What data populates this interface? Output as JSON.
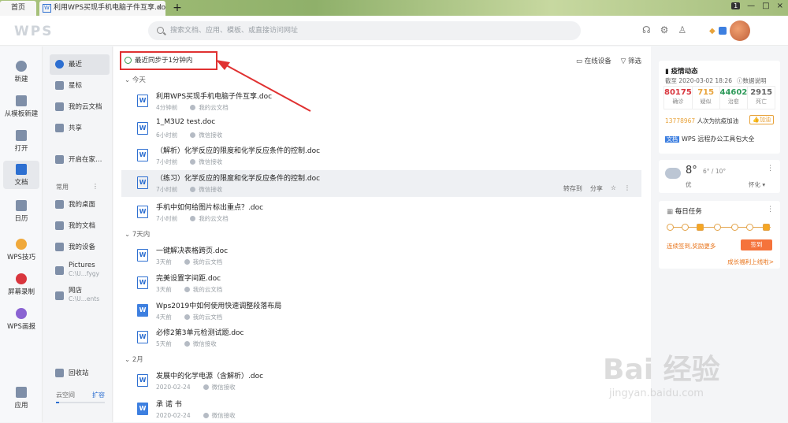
{
  "tabs": {
    "home": "首页",
    "doc": "利用WPS买现手机电脑子件互享.doc",
    "close": "×",
    "add": "+"
  },
  "window": {
    "count_badge": "1",
    "min": "—",
    "restore": "□",
    "close": "×"
  },
  "title": {
    "logo": "WPS",
    "search_placeholder": "搜索文档、应用、模板、或直接访问网址"
  },
  "leftnav": [
    "新建",
    "从模板新建",
    "打开",
    "文档",
    "日历",
    "WPS技巧",
    "屏幕录制",
    "WPS画报",
    "应用"
  ],
  "subnav": {
    "items": [
      "最近",
      "星标",
      "我的云文档",
      "共享",
      "开启在家…"
    ],
    "section": "常用",
    "section_more": "⋮",
    "common": [
      {
        "label": "我的桌面"
      },
      {
        "label": "我的文档"
      },
      {
        "label": "我的设备"
      },
      {
        "label": "Pictures",
        "sub": "C:\\U...fygy"
      },
      {
        "label": "网店",
        "sub": "C:\\U...ents"
      }
    ],
    "recycle": "回收站",
    "cloud": "云空间",
    "expand": "扩容"
  },
  "main": {
    "sync": "最近同步于1分钟内",
    "tools": [
      "在线设备",
      "筛选"
    ],
    "groups": [
      "今天",
      "7天内",
      "2月"
    ],
    "files": [
      {
        "name": "利用WPS买现手机电脑子件互享.doc",
        "time": "4分钟前",
        "loc": "我的云文档"
      },
      {
        "name": "1_M3U2 test.doc",
        "time": "6小时前",
        "loc": "微信接收"
      },
      {
        "name": "（解析）化学反应的限度和化学反应条件的控制.doc",
        "time": "7小时前",
        "loc": "微信接收"
      },
      {
        "name": "（练习）化学反应的限度和化学反应条件的控制.doc",
        "time": "7小时前",
        "loc": "微信接收"
      },
      {
        "name": "手机中如何给图片标出重点？.doc",
        "time": "7小时前",
        "loc": "我的云文档"
      },
      {
        "name": "一键解决表格跨页.doc",
        "time": "3天前",
        "loc": "我的云文档"
      },
      {
        "name": "完美设置字间距.doc",
        "time": "3天前",
        "loc": "我的云文档"
      },
      {
        "name": "Wps2019中如何使用快速调整段落布局",
        "time": "4天前",
        "loc": "我的云文档"
      },
      {
        "name": "必修2第3单元检测试题.doc",
        "time": "5天前",
        "loc": "微信接收"
      },
      {
        "name": "发展中的化学电源（含解析）.doc",
        "time": "2020-02-24",
        "loc": "微信接收"
      },
      {
        "name": "承 诺 书",
        "time": "2020-02-24",
        "loc": "微信接收"
      }
    ],
    "row_actions": [
      "转存到",
      "分享",
      "☆",
      "⋮"
    ]
  },
  "covid": {
    "title": "疫情动态",
    "date": "截至 2020-03-02 18:26",
    "explain": "数据说明",
    "stats": [
      {
        "num": "80175",
        "label": "确诊",
        "color": "#d9363e"
      },
      {
        "num": "715",
        "label": "疑似",
        "color": "#e8a33b"
      },
      {
        "num": "44602",
        "label": "治愈",
        "color": "#2e9a5a"
      },
      {
        "num": "2915",
        "label": "死亡",
        "color": "#666666"
      }
    ],
    "help_num": "13778967",
    "help_text": "人次为抗疫加油",
    "like": "加油",
    "promo_tag": "文档",
    "promo": "WPS 远程办公工具包大全"
  },
  "weather": {
    "temp": "8°",
    "range": "6° / 10°",
    "desc": "优",
    "city": "怀化 ▾",
    "more": "⋮"
  },
  "task": {
    "title": "每日任务",
    "more": "⋮",
    "checkin_text": "连续签到,奖励更多",
    "checkin_btn": "签到",
    "growth": "成长福利上线啦>"
  },
  "watermark": {
    "brand": "Bai 经验",
    "url": "jingyan.baidu.com"
  },
  "colors": {
    "accent": "#2d6fd1",
    "highlight": "#e03131"
  }
}
